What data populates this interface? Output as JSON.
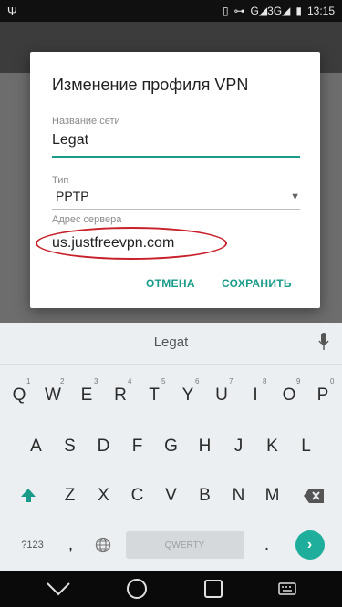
{
  "status_bar": {
    "time": "13:15",
    "network": "G◢3G◢"
  },
  "dialog": {
    "title": "Изменение профиля VPN",
    "name_label": "Название сети",
    "name_value": "Legat",
    "type_label": "Тип",
    "type_value": "PPTP",
    "server_label": "Адрес сервера",
    "server_value": "us.justfreevpn.com",
    "cancel_label": "ОТМЕНА",
    "save_label": "СОХРАНИТЬ"
  },
  "keyboard": {
    "suggestion": "Legat",
    "row1": [
      "Q",
      "W",
      "E",
      "R",
      "T",
      "Y",
      "U",
      "I",
      "O",
      "P"
    ],
    "row1_digits": [
      "1",
      "2",
      "3",
      "4",
      "5",
      "6",
      "7",
      "8",
      "9",
      "0"
    ],
    "row2": [
      "A",
      "S",
      "D",
      "F",
      "G",
      "H",
      "J",
      "K",
      "L"
    ],
    "row3": [
      "Z",
      "X",
      "C",
      "V",
      "B",
      "N",
      "M"
    ],
    "symbols_label": "?123",
    "comma": ",",
    "space_label": "QWERTY",
    "period": "."
  },
  "colors": {
    "accent": "#1a9b8a",
    "highlight": "#c8202a"
  }
}
